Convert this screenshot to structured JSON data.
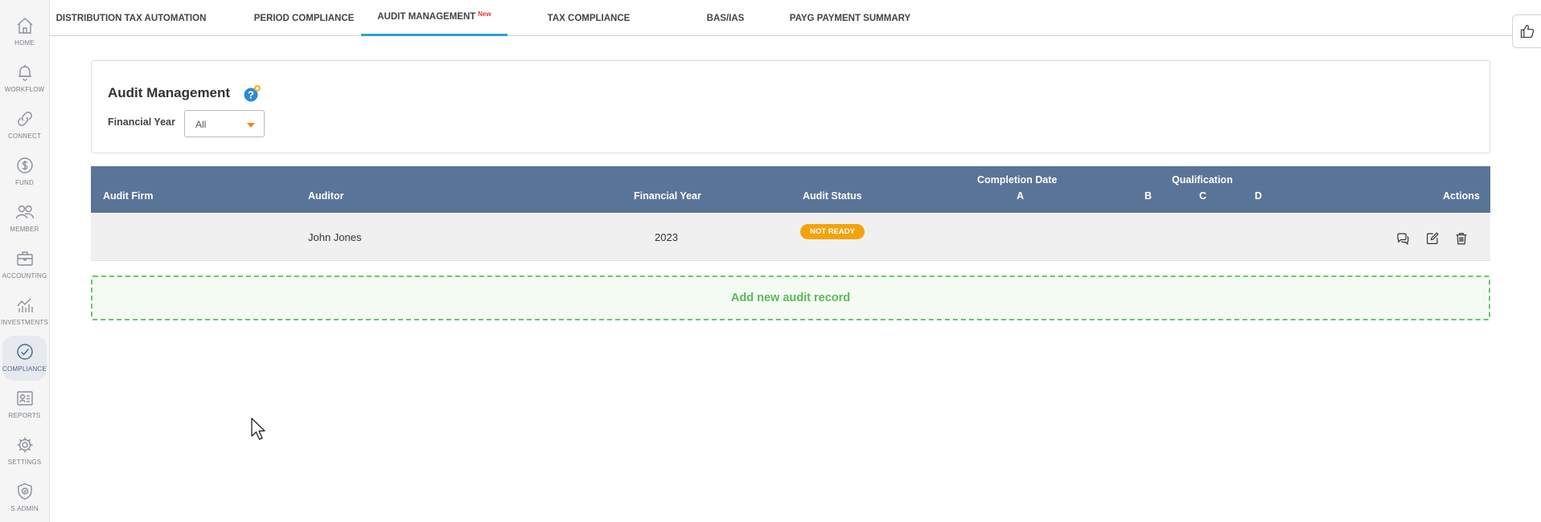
{
  "sidebar": {
    "items": [
      {
        "label": "HOME",
        "icon": "home-icon"
      },
      {
        "label": "WORKFLOW",
        "icon": "bell-icon"
      },
      {
        "label": "CONNECT",
        "icon": "link-icon"
      },
      {
        "label": "FUND",
        "icon": "dollar-icon"
      },
      {
        "label": "MEMBER",
        "icon": "members-icon"
      },
      {
        "label": "ACCOUNTING",
        "icon": "briefcase-icon"
      },
      {
        "label": "INVESTMENTS",
        "icon": "chart-icon"
      },
      {
        "label": "COMPLIANCE",
        "icon": "check-circle-icon",
        "active": true
      },
      {
        "label": "REPORTS",
        "icon": "report-icon"
      },
      {
        "label": "SETTINGS",
        "icon": "gear-icon"
      },
      {
        "label": "S.ADMIN",
        "icon": "shield-icon"
      }
    ]
  },
  "tabs": [
    {
      "label": "DISTRIBUTION TAX AUTOMATION"
    },
    {
      "label": "PERIOD COMPLIANCE"
    },
    {
      "label": "AUDIT MANAGEMENT",
      "badge": "New",
      "active": true
    },
    {
      "label": "TAX COMPLIANCE"
    },
    {
      "label": "BAS/IAS"
    },
    {
      "label": "PAYG PAYMENT SUMMARY"
    }
  ],
  "header": {
    "title": "Audit Management",
    "financial_year_label": "Financial Year",
    "financial_year_value": "All"
  },
  "table": {
    "columns": {
      "audit_firm": "Audit Firm",
      "auditor": "Auditor",
      "financial_year": "Financial Year",
      "audit_status": "Audit Status",
      "completion_date": "Completion Date",
      "qualification": "Qualification",
      "qual_a": "A",
      "qual_b": "B",
      "qual_c": "C",
      "qual_d": "D",
      "actions": "Actions"
    },
    "rows": [
      {
        "audit_firm": "",
        "auditor": "John Jones",
        "financial_year": "2023",
        "audit_status": "NOT READY"
      }
    ]
  },
  "add_record_label": "Add new audit record",
  "colors": {
    "accent": "#2aa1d3",
    "table_header": "#5a7498",
    "status_not_ready": "#f4a20c",
    "add_record": "#5cb85c",
    "new_badge": "#e03a3a"
  }
}
